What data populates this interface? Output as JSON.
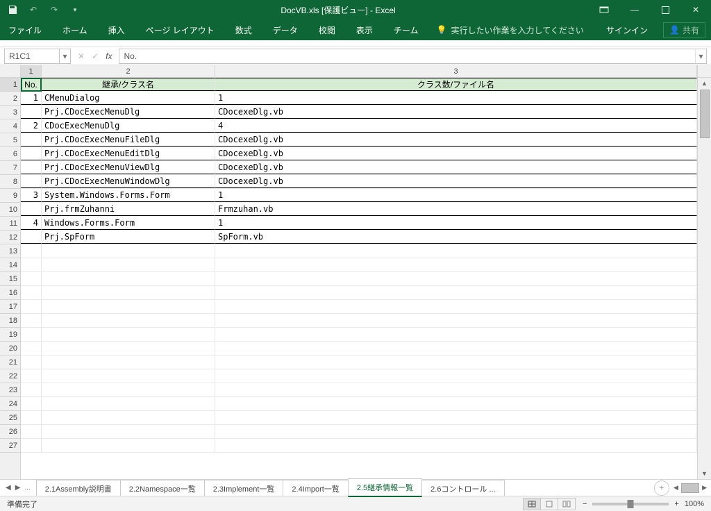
{
  "title": "DocVB.xls  [保護ビュー] - Excel",
  "qat": {
    "save": "save",
    "undo": "undo",
    "redo": "redo",
    "custom": "▾"
  },
  "win": {
    "rib_opts": "▭",
    "min": "—",
    "max": "▭",
    "close": "✕"
  },
  "ribbon_tabs": [
    "ファイル",
    "ホーム",
    "挿入",
    "ページ レイアウト",
    "数式",
    "データ",
    "校閲",
    "表示",
    "チーム"
  ],
  "tell_me_placeholder": "実行したい作業を入力してください",
  "signin_label": "サインイン",
  "share_label": "共有",
  "namebox": "R1C1",
  "formula": "No.",
  "col_headers": [
    "1",
    "2",
    "3"
  ],
  "table_headers": {
    "no": "No.",
    "col2": "継承/クラス名",
    "col3": "クラス数/ファイル名"
  },
  "rows": [
    {
      "no": "1",
      "c2": "CMenuDialog",
      "c3": "1"
    },
    {
      "no": "",
      "c2": "Prj.CDocExecMenuDlg",
      "c3": "CDocexeDlg.vb"
    },
    {
      "no": "2",
      "c2": "CDocExecMenuDlg",
      "c3": "4"
    },
    {
      "no": "",
      "c2": "Prj.CDocExecMenuFileDlg",
      "c3": "CDocexeDlg.vb"
    },
    {
      "no": "",
      "c2": "Prj.CDocExecMenuEditDlg",
      "c3": "CDocexeDlg.vb"
    },
    {
      "no": "",
      "c2": "Prj.CDocExecMenuViewDlg",
      "c3": "CDocexeDlg.vb"
    },
    {
      "no": "",
      "c2": "Prj.CDocExecMenuWindowDlg",
      "c3": "CDocexeDlg.vb"
    },
    {
      "no": "3",
      "c2": "System.Windows.Forms.Form",
      "c3": "1"
    },
    {
      "no": "",
      "c2": "Prj.frmZuhanni",
      "c3": "Frmzuhan.vb"
    },
    {
      "no": "4",
      "c2": "Windows.Forms.Form",
      "c3": "1"
    },
    {
      "no": "",
      "c2": "Prj.SpForm",
      "c3": "SpForm.vb"
    }
  ],
  "empty_rows": 15,
  "sheet_tabs": [
    "2.1Assembly説明書",
    "2.2Namespace一覧",
    "2.3Implement一覧",
    "2.4Import一覧",
    "2.5継承情報一覧",
    "2.6コントロール ..."
  ],
  "active_sheet": "2.5継承情報一覧",
  "status_text": "準備完了",
  "zoom_label": "100%"
}
